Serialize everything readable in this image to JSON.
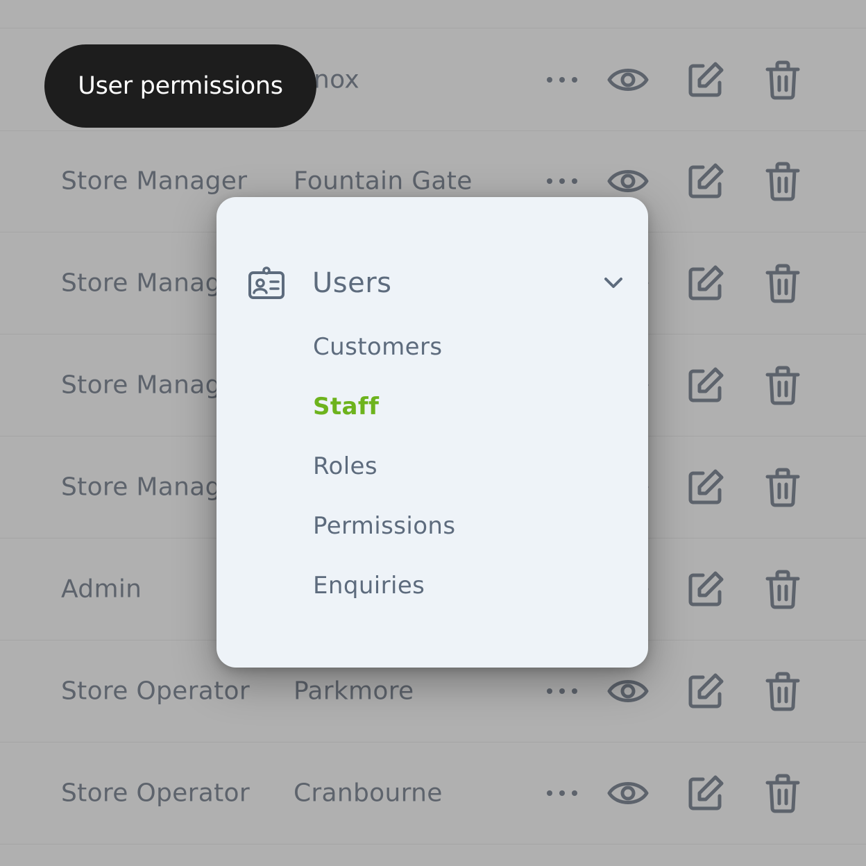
{
  "badge": {
    "label": "User permissions"
  },
  "rows": [
    {
      "role": "",
      "store": "nox"
    },
    {
      "role": "Store Manager",
      "store": "Fountain Gate"
    },
    {
      "role": "Store Manag",
      "store": ""
    },
    {
      "role": "Store Manag",
      "store": ""
    },
    {
      "role": "Store Manag",
      "store": ""
    },
    {
      "role": "Admin",
      "store": ""
    },
    {
      "role": "Store Operator",
      "store": "Parkmore"
    },
    {
      "role": "Store Operator",
      "store": "Cranbourne"
    }
  ],
  "row_actions": [
    "more-icon",
    "eye-icon",
    "edit-icon",
    "trash-icon"
  ],
  "menu": {
    "title": "Users",
    "icon": "id-card-icon",
    "expand_icon": "chevron-down-icon",
    "items": [
      {
        "label": "Customers",
        "active": false
      },
      {
        "label": "Staff",
        "active": true
      },
      {
        "label": "Roles",
        "active": false
      },
      {
        "label": "Permissions",
        "active": false
      },
      {
        "label": "Enquiries",
        "active": false
      }
    ]
  },
  "colors": {
    "background_overlay": "#b0b0b0",
    "text_muted": "#5d636c",
    "menu_bg": "#eef3f8",
    "menu_text": "#5d6b7d",
    "active": "#6db31d",
    "badge_bg": "#1d1d1d",
    "badge_text": "#ffffff"
  }
}
